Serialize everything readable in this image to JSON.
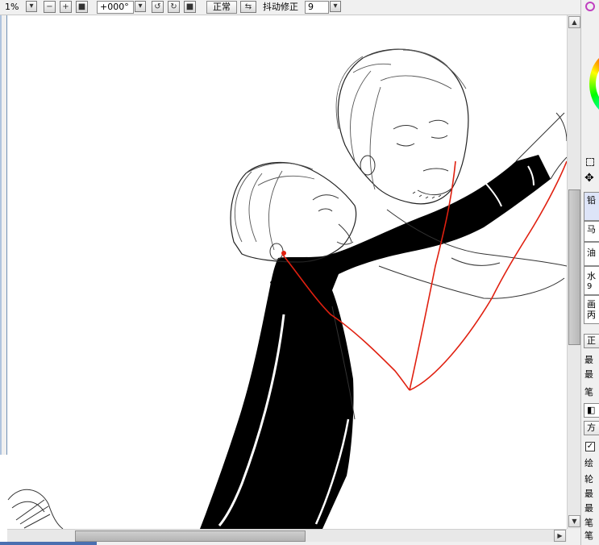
{
  "toolbar": {
    "zoom_value": "1%",
    "rotation_value": "+000°",
    "blend_mode": "正常",
    "stabilizer_label": "抖动修正",
    "stabilizer_value": "9"
  },
  "right_panel": {
    "items": [
      "铅",
      "马",
      "油",
      "水",
      "9",
      "画",
      "丙",
      "正",
      "最",
      "最",
      "笔",
      "方",
      "绘",
      "轮",
      "最",
      "最",
      "笔",
      "笔"
    ]
  },
  "colors": {
    "brush_line": "#e02010",
    "ink": "#000000",
    "scroll_thumb": "#bfbfbf"
  }
}
